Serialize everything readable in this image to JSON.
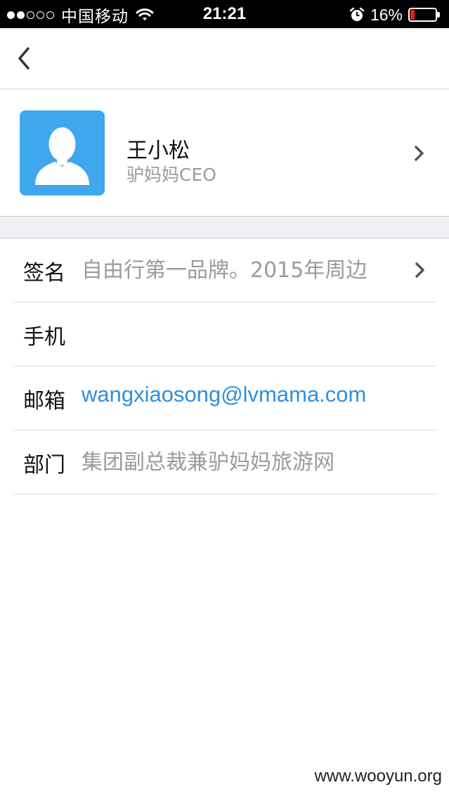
{
  "status_bar": {
    "carrier": "中国移动",
    "time": "21:21",
    "battery_percent": "16%",
    "battery_level": 0.16,
    "signal_strength": 2,
    "signal_max": 5,
    "icons": [
      "wifi-icon",
      "alarm-icon",
      "battery-icon"
    ]
  },
  "nav": {
    "back_icon": "chevron-left-icon"
  },
  "profile": {
    "name": "王小松",
    "title": "驴妈妈CEO",
    "avatar_color": "#3ea7ee"
  },
  "details": [
    {
      "label": "签名",
      "value": "自由行第一品牌。2015年周边",
      "has_arrow": true
    },
    {
      "label": "手机",
      "value": "",
      "has_arrow": false
    },
    {
      "label": "邮箱",
      "value": "wangxiaosong@lvmama.com",
      "has_arrow": false,
      "link_color": "#2f8ee0"
    },
    {
      "label": "部门",
      "value": "集团副总裁兼驴妈妈旅游网",
      "has_arrow": false
    }
  ],
  "watermark": "www.wooyun.org"
}
